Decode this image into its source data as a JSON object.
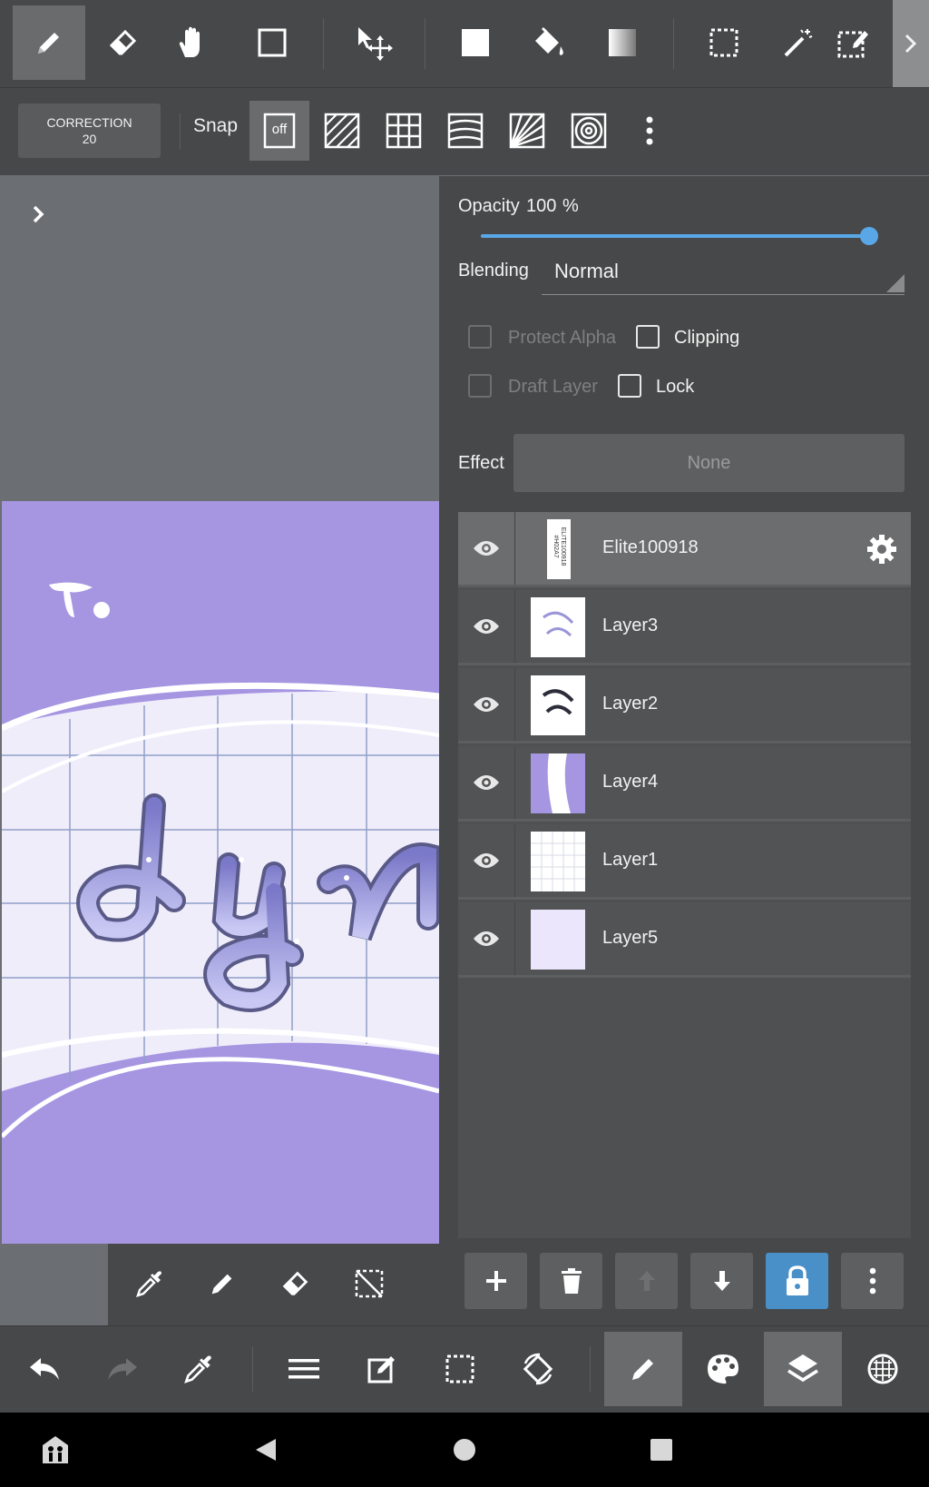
{
  "top_toolbar": {
    "tools": [
      "pen-icon",
      "eraser-icon",
      "hand-icon",
      "shape-icon",
      "move-icon",
      "fill-rect-icon",
      "bucket-icon",
      "gradient-icon",
      "select-rect-icon",
      "magic-wand-icon",
      "select-pen-icon"
    ],
    "active_tool": "pen-icon"
  },
  "snap_bar": {
    "correction_label": "CORRECTION",
    "correction_value": "20",
    "snap_label": "Snap",
    "snap_off_label": "off"
  },
  "layer_props": {
    "opacity_label": "Opacity",
    "opacity_value": "100",
    "opacity_unit": "%",
    "opacity_fraction": 1.0,
    "blending_label": "Blending",
    "blending_value": "Normal",
    "protect_alpha_label": "Protect Alpha",
    "clipping_label": "Clipping",
    "draft_layer_label": "Draft Layer",
    "lock_label": "Lock",
    "effect_label": "Effect",
    "effect_value": "None"
  },
  "layers": [
    {
      "name": "Elite100918",
      "selected": true
    },
    {
      "name": "Layer3",
      "selected": false
    },
    {
      "name": "Layer2",
      "selected": false
    },
    {
      "name": "Layer4",
      "selected": false
    },
    {
      "name": "Layer1",
      "selected": false
    },
    {
      "name": "Layer5",
      "selected": false
    }
  ],
  "thumbnail_text": {
    "elite_line1": "ELITE100918",
    "elite_line2": "#H02A7"
  },
  "colors": {
    "accent": "#5aa7e8",
    "lock_active": "#4a90c8",
    "artboard_purple": "#a696e2",
    "panel_bg": "#474849"
  },
  "bottom_toolbar": {
    "tools": [
      "undo-icon",
      "redo-icon",
      "eyedropper-icon",
      "menu-icon",
      "edit-icon",
      "selection-icon",
      "rotate-icon",
      "brush-icon",
      "palette-icon",
      "layers-icon",
      "materials-icon"
    ],
    "active": [
      "brush-icon",
      "layers-icon"
    ]
  }
}
